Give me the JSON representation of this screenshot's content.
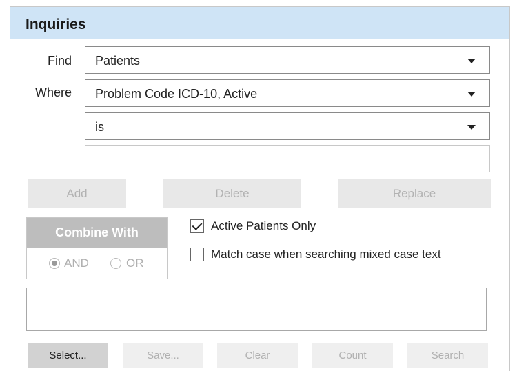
{
  "title": "Inquiries",
  "find": {
    "label": "Find",
    "value": "Patients"
  },
  "where": {
    "label": "Where",
    "value": "Problem Code ICD-10, Active"
  },
  "operator": {
    "value": "is"
  },
  "criteria_value": "",
  "actions": {
    "add": "Add",
    "delete": "Delete",
    "replace": "Replace"
  },
  "combine": {
    "title": "Combine With",
    "options": [
      {
        "label": "AND",
        "selected": true
      },
      {
        "label": "OR",
        "selected": false
      }
    ]
  },
  "checkboxes": [
    {
      "label": "Active Patients Only",
      "checked": true
    },
    {
      "label": "Match case when searching mixed case text",
      "checked": false
    }
  ],
  "query_text": "",
  "footer": {
    "select": "Select...",
    "save": "Save...",
    "clear": "Clear",
    "count": "Count",
    "search": "Search"
  }
}
